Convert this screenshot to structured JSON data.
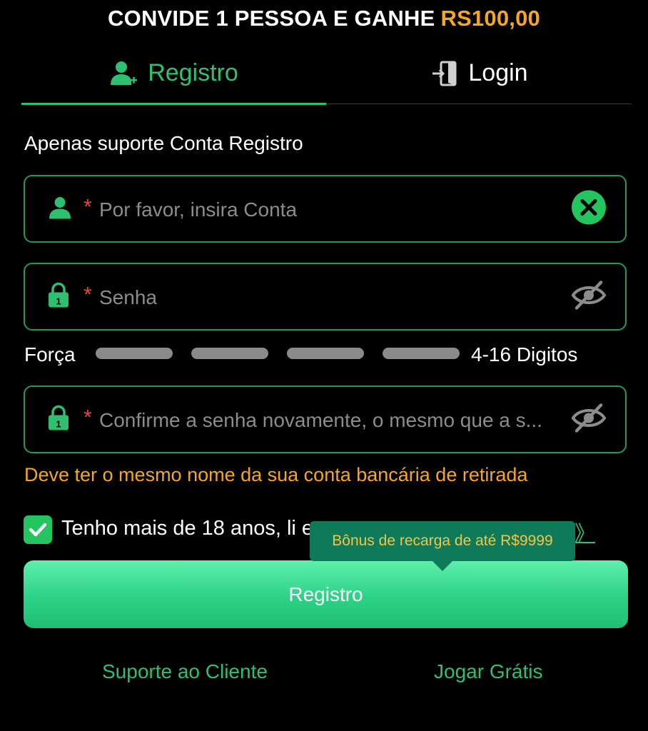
{
  "banner": {
    "text": "CONVIDE 1 PESSOA E GANHE",
    "amount": "RS100,00"
  },
  "tabs": [
    {
      "label": "Registro",
      "icon": "user-add-icon",
      "active": true
    },
    {
      "label": "Login",
      "icon": "login-door-icon",
      "active": false
    }
  ],
  "form": {
    "hint": "Apenas suporte Conta Registro",
    "account_placeholder": "Por favor, insira Conta",
    "password_placeholder": "Senha",
    "confirm_placeholder": "Confirme a senha novamente, o mesmo que a s...",
    "required_mark": "*",
    "strength_label": "Força",
    "strength_level": 0,
    "digits_hint": "4-16 Digitos",
    "warning": "Deve ter o mesmo nome da sua conta bancária de retirada",
    "agree_text": "Tenho mais de 18 anos, li e",
    "agree_link_fragment": "》",
    "agree_checked": true
  },
  "tooltip": "Bônus de recarga de até R$9999",
  "submit_label": "Registro",
  "footer": {
    "support": "Suporte ao Cliente",
    "play_free": "Jogar Grátis"
  },
  "colors": {
    "accent": "#2fbf71",
    "warning": "#f5a623",
    "required": "#e8453c",
    "tooltip_bg": "#0e7a59"
  }
}
